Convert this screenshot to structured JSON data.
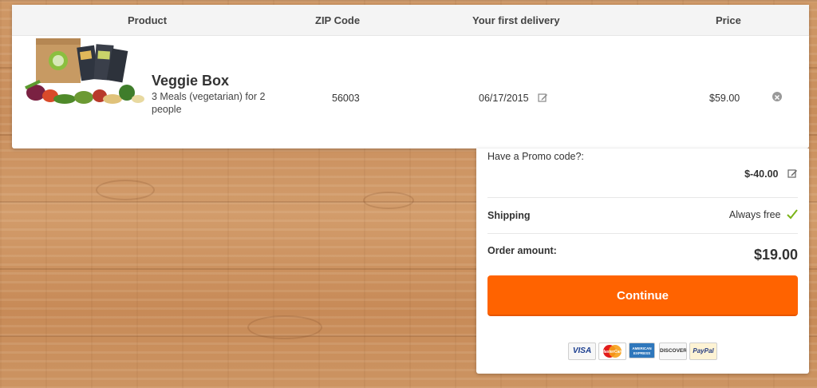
{
  "table": {
    "headers": {
      "product": "Product",
      "zip": "ZIP Code",
      "delivery": "Your first delivery",
      "price": "Price"
    },
    "row": {
      "name": "Veggie Box",
      "description": "3 Meals (vegetarian) for 2 people",
      "zip": "56003",
      "delivery_date": "06/17/2015",
      "price": "$59.00"
    }
  },
  "summary": {
    "promo_label": "Have a Promo code?:",
    "promo_value": "$-40.00",
    "shipping_label": "Shipping",
    "shipping_value": "Always free",
    "order_label": "Order amount:",
    "order_value": "$19.00",
    "continue_label": "Continue",
    "payment_methods": [
      "VISA",
      "MasterCard",
      "AMERICAN EXPRESS",
      "DISCOVER",
      "PayPal"
    ]
  },
  "colors": {
    "accent": "#ff6300",
    "check": "#7ab317"
  },
  "icons": [
    "edit-icon",
    "remove-icon",
    "checkmark-icon"
  ]
}
